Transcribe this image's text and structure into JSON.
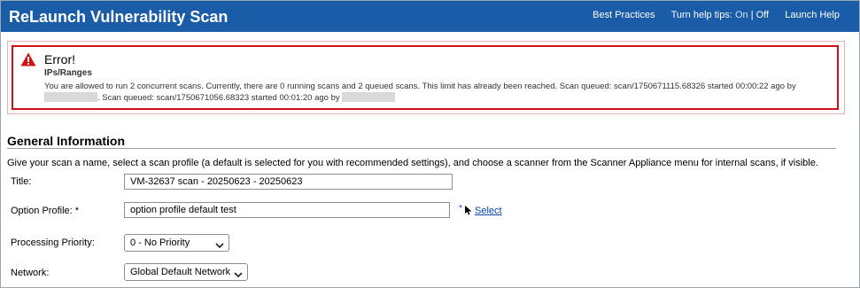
{
  "header": {
    "title": "ReLaunch Vulnerability Scan",
    "best_practices": "Best Practices",
    "help_tips_label": "Turn help tips:",
    "help_tips_on": "On",
    "help_tips_sep": "|",
    "help_tips_off": "Off",
    "launch_help": "Launch Help"
  },
  "error": {
    "title": "Error!",
    "subtitle": "IPs/Ranges",
    "message_part1": "You are allowed to run 2 concurrent scans. Currently, there are 0 running scans and 2 queued scans. This limit has already been reached. Scan queued: scan/1750671115.68326 started 00:00:22 ago by",
    "message_part2": ". Scan queued: scan/1750671056.68323 started 00:01:20 ago by"
  },
  "general": {
    "section_title": "General Information",
    "intro": "Give your scan a name, select a scan profile (a default is selected for you with recommended settings), and choose a scanner from the Scanner Appliance menu for internal scans, if visible.",
    "title_label": "Title:",
    "title_value": "VM-32637 scan - 20250623 - 20250623",
    "option_profile_label": "Option Profile: *",
    "option_profile_value": "option profile default test",
    "select_link": "Select",
    "select_link_prefix": "*",
    "processing_priority_label": "Processing Priority:",
    "processing_priority_value": "0 - No Priority",
    "network_label": "Network:",
    "network_value": "Global Default Network"
  },
  "colors": {
    "titlebar": "#1a5ca8",
    "error_border": "#d40f14",
    "link": "#0645ad"
  },
  "icons": [
    "warning-icon",
    "chevron-down-icon",
    "cursor-icon"
  ]
}
